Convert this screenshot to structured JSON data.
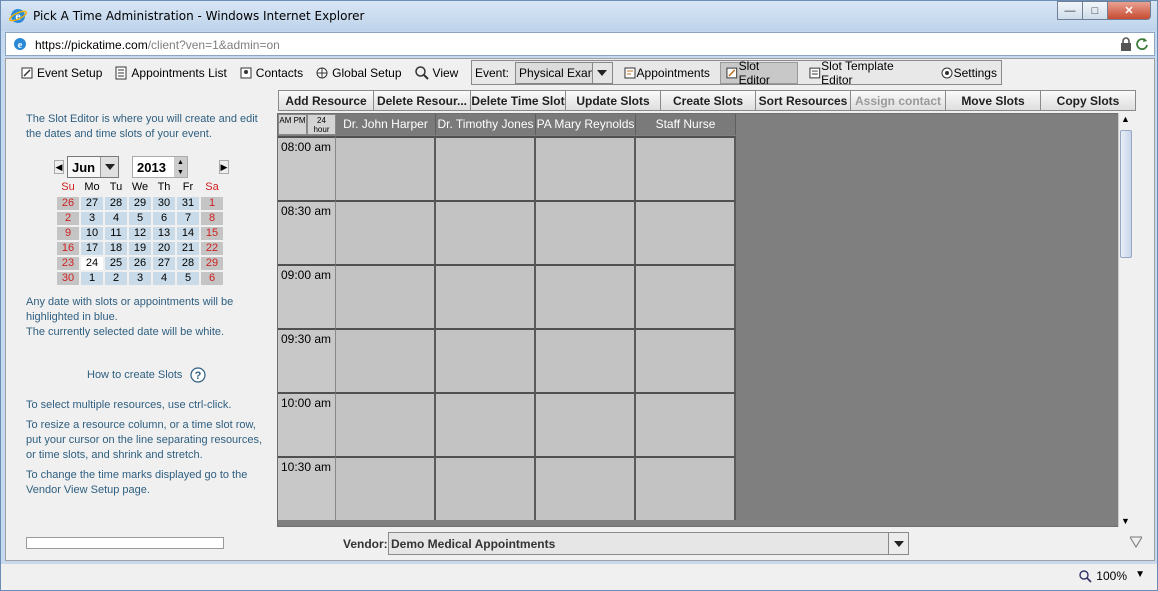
{
  "window": {
    "title": "Pick A Time Administration - Windows Internet Explorer",
    "url_domain": "https://pickatime.com",
    "url_rest": "/client?ven=1&admin=on"
  },
  "menu": {
    "items": [
      "Event Setup",
      "Appointments List",
      "Contacts",
      "Global Setup",
      "View"
    ],
    "event_label": "Event:",
    "event_value": "Physical Exam",
    "tabs": [
      "Appointments",
      "Slot Editor",
      "Slot Template Editor",
      "Settings"
    ],
    "active_tab": "Slot Editor"
  },
  "help": {
    "intro": "The Slot Editor is where you will create and edit the dates and time slots of your event.",
    "highlight": "Any date with slots or appointments will be highlighted in blue.",
    "selected": "The currently selected date will be white.",
    "how_to": "How to create Slots",
    "multi": "To select multiple resources, use ctrl-click.",
    "resize": "To resize a resource column, or a time slot row, put your cursor on the line separating resources, or time slots, and shrink and stretch.",
    "timemarks": "To change the time marks displayed go to the Vendor View Setup page."
  },
  "calendar": {
    "month": "Jun",
    "year": "2013",
    "dow": [
      "Su",
      "Mo",
      "Tu",
      "We",
      "Th",
      "Fr",
      "Sa"
    ],
    "weeks": [
      [
        "26",
        "27",
        "28",
        "29",
        "30",
        "31",
        "1"
      ],
      [
        "2",
        "3",
        "4",
        "5",
        "6",
        "7",
        "8"
      ],
      [
        "9",
        "10",
        "11",
        "12",
        "13",
        "14",
        "15"
      ],
      [
        "16",
        "17",
        "18",
        "19",
        "20",
        "21",
        "22"
      ],
      [
        "23",
        "24",
        "25",
        "26",
        "27",
        "28",
        "29"
      ],
      [
        "30",
        "1",
        "2",
        "3",
        "4",
        "5",
        "6"
      ]
    ],
    "selected": "24"
  },
  "actions": [
    {
      "label": "Add Resource",
      "enabled": true
    },
    {
      "label": "Delete Resour...",
      "enabled": true
    },
    {
      "label": "Delete Time Slot",
      "enabled": true
    },
    {
      "label": "Update Slots",
      "enabled": true
    },
    {
      "label": "Create Slots",
      "enabled": true
    },
    {
      "label": "Sort Resources",
      "enabled": true
    },
    {
      "label": "Assign contact",
      "enabled": false
    },
    {
      "label": "Move Slots",
      "enabled": true
    },
    {
      "label": "Copy Slots",
      "enabled": true
    }
  ],
  "grid": {
    "toggle_ampm": "AM PM",
    "toggle_24": "24 hour",
    "resources": [
      "Dr. John Harper",
      "Dr. Timothy Jones",
      "PA Mary Reynolds",
      "Staff Nurse"
    ],
    "times": [
      "08:00 am",
      "08:30 am",
      "09:00 am",
      "09:30 am",
      "10:00 am",
      "10:30 am"
    ]
  },
  "footer": {
    "vendor_label": "Vendor:",
    "vendor_value": "Demo Medical Appointments"
  },
  "status": {
    "zoom": "100%"
  },
  "colors": {
    "accent_text": "#2f5f80",
    "weekend_red": "#d02020",
    "slot_blue": "#c9dbe8"
  }
}
